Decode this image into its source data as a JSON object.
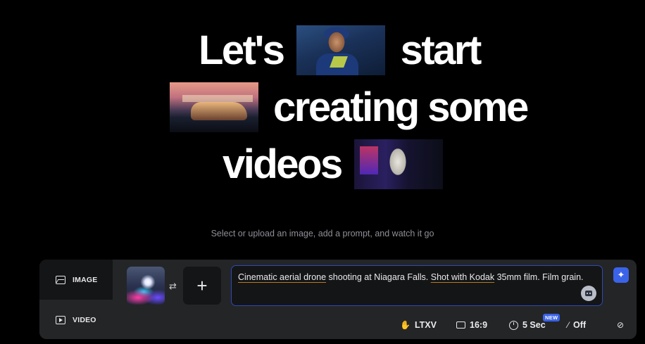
{
  "hero": {
    "line1_word1": "Let's",
    "line1_word2": "start",
    "line2_word": "creating some",
    "line3_word": "videos"
  },
  "tagline": "Select or upload an image, add a prompt, and watch it go",
  "modes": [
    {
      "label": "IMAGE",
      "icon": "image-icon",
      "active": true
    },
    {
      "label": "VIDEO",
      "icon": "video-icon",
      "active": false
    }
  ],
  "prompt": {
    "text_part1": "Cinematic aerial drone",
    "text_part2": " shooting at Niagara Falls. ",
    "text_part3": "Shot with Kodak",
    "text_part4": " 35mm film. Film grain."
  },
  "add_button": "+",
  "swap_icon": "⇄",
  "options": {
    "model": {
      "icon": "model-icon",
      "label": "LTXV"
    },
    "ratio": {
      "icon": "aspect-ratio-icon",
      "label": "16:9"
    },
    "duration": {
      "icon": "clock-icon",
      "label": "5 Sec",
      "badge": "NEW"
    },
    "audio": {
      "icon": "audio-off-icon",
      "label": "Off"
    },
    "link": {
      "icon": "link-icon"
    }
  },
  "colors": {
    "accent": "#3a63e8",
    "panel": "#242527",
    "background": "#000000"
  }
}
